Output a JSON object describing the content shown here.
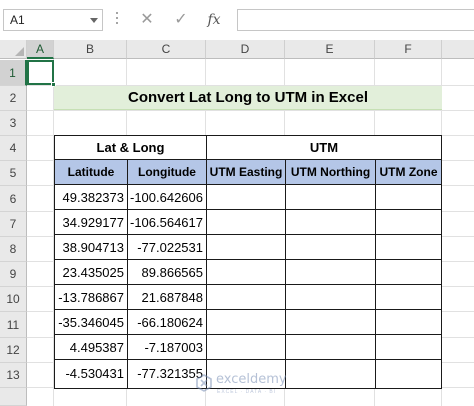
{
  "formula_bar": {
    "name_box": "A1",
    "cancel_icon": "close-icon",
    "enter_icon": "check-icon",
    "function_label": "fx",
    "formula": ""
  },
  "columns": [
    "A",
    "B",
    "C",
    "D",
    "E",
    "F"
  ],
  "rows": [
    "1",
    "2",
    "3",
    "4",
    "5",
    "6",
    "7",
    "8",
    "9",
    "10",
    "11",
    "12",
    "13"
  ],
  "selected_cell": "A1",
  "title": "Convert Lat Long to UTM in Excel",
  "table": {
    "group_headers": [
      "Lat & Long",
      "UTM"
    ],
    "headers": [
      "Latitude",
      "Longitude",
      "UTM Easting",
      "UTM Northing",
      "UTM Zone"
    ],
    "rows": [
      [
        "49.382373",
        "-100.642606",
        "",
        "",
        ""
      ],
      [
        "34.929177",
        "-106.564617",
        "",
        "",
        ""
      ],
      [
        "38.904713",
        "-77.022531",
        "",
        "",
        ""
      ],
      [
        "23.435025",
        "89.866565",
        "",
        "",
        ""
      ],
      [
        "-13.786867",
        "21.687848",
        "",
        "",
        ""
      ],
      [
        "-35.346045",
        "-66.180624",
        "",
        "",
        ""
      ],
      [
        "4.495387",
        "-7.187003",
        "",
        "",
        ""
      ],
      [
        "-4.530431",
        "-77.321355",
        "",
        "",
        ""
      ]
    ]
  },
  "colors": {
    "title_fill": "#e2efda",
    "header_fill": "#b4c6e7",
    "selection": "#217346"
  },
  "watermark": {
    "name": "exceldemy",
    "tagline": "EXCEL · DATA · BI"
  }
}
